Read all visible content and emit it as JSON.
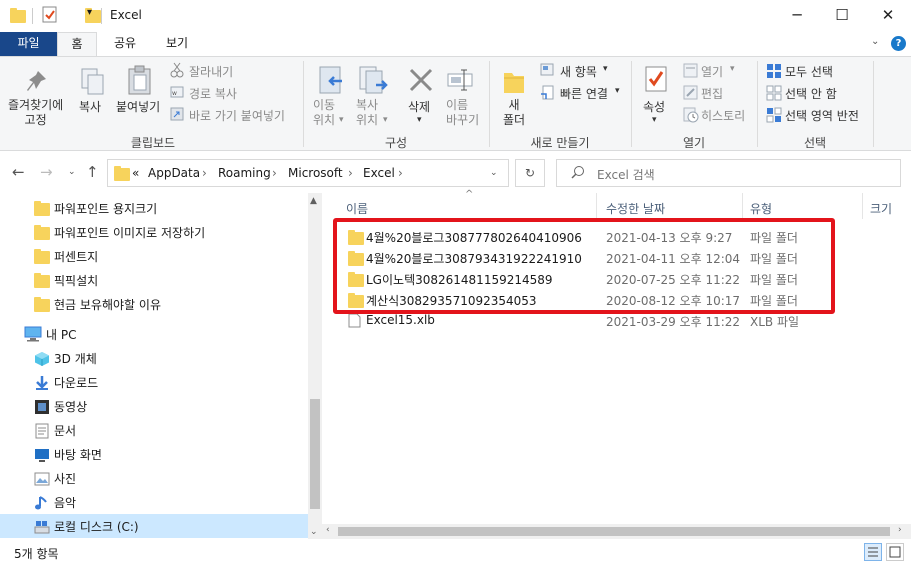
{
  "window": {
    "title": "Excel",
    "minimize": "─",
    "maximize": "☐",
    "close": "✕"
  },
  "ribbon_tabs": [
    "파일",
    "홈",
    "공유",
    "보기"
  ],
  "ribbon": {
    "clipboard": {
      "pin": "즐겨찾기에\n고정",
      "copy": "복사",
      "paste": "붙여넣기",
      "cut": "잘라내기",
      "copy_path": "경로 복사",
      "paste_shortcut": "바로 가기 붙여넣기",
      "group": "클립보드"
    },
    "organize": {
      "move_to": "이동\n위치",
      "copy_to": "복사\n위치",
      "delete": "삭제",
      "rename": "이름\n바꾸기",
      "group": "구성"
    },
    "new": {
      "new_folder": "새\n폴더",
      "new_item": "새 항목",
      "easy_access": "빠른 연결",
      "group": "새로 만들기"
    },
    "open": {
      "properties": "속성",
      "open": "열기",
      "edit": "편집",
      "history": "히스토리",
      "group": "열기"
    },
    "select": {
      "select_all": "모두 선택",
      "select_none": "선택 안 함",
      "invert": "선택 영역 반전",
      "group": "선택"
    }
  },
  "address": {
    "prefix": "«",
    "crumbs": [
      "AppData",
      "Roaming",
      "Microsoft",
      "Excel"
    ],
    "search_placeholder": "Excel 검색"
  },
  "nav_items": [
    {
      "label": "파워포인트 용지크기",
      "icon": "folder-icon"
    },
    {
      "label": "파워포인트 이미지로 저장하기",
      "icon": "folder-icon"
    },
    {
      "label": "퍼센트지",
      "icon": "folder-icon"
    },
    {
      "label": "픽픽설치",
      "icon": "folder-icon"
    },
    {
      "label": "현금 보유해야할 이유",
      "icon": "folder-icon"
    },
    {
      "label": "내 PC",
      "icon": "pc-icon"
    },
    {
      "label": "3D 개체",
      "icon": "cube-icon"
    },
    {
      "label": "다운로드",
      "icon": "download-icon"
    },
    {
      "label": "동영상",
      "icon": "video-icon"
    },
    {
      "label": "문서",
      "icon": "document-icon"
    },
    {
      "label": "바탕 화면",
      "icon": "desktop-icon"
    },
    {
      "label": "사진",
      "icon": "picture-icon"
    },
    {
      "label": "음악",
      "icon": "music-icon"
    },
    {
      "label": "로컬 디스크 (C:)",
      "icon": "drive-icon"
    }
  ],
  "columns": [
    "이름",
    "수정한 날짜",
    "유형",
    "크기"
  ],
  "files": [
    {
      "name": "4월%20블로그308777802640410906",
      "date": "2021-04-13 오후 9:27",
      "type": "파일 폴더",
      "icon": "folder-icon"
    },
    {
      "name": "4월%20블로그308793431922241910",
      "date": "2021-04-11 오후 12:04",
      "type": "파일 폴더",
      "icon": "folder-icon"
    },
    {
      "name": "LG이노텍308261481159214589",
      "date": "2020-07-25 오후 11:22",
      "type": "파일 폴더",
      "icon": "folder-icon"
    },
    {
      "name": "계산식308293571092354053",
      "date": "2020-08-12 오후 10:17",
      "type": "파일 폴더",
      "icon": "folder-icon"
    },
    {
      "name": "Excel15.xlb",
      "date": "2021-03-29 오후 11:22",
      "type": "XLB 파일",
      "icon": "file-icon"
    }
  ],
  "status": {
    "count": "5개 항목"
  },
  "colors": {
    "file_tab": "#19478a",
    "highlight_box": "#e3141b",
    "folder": "#f7d35c",
    "selection": "#cce8ff"
  }
}
